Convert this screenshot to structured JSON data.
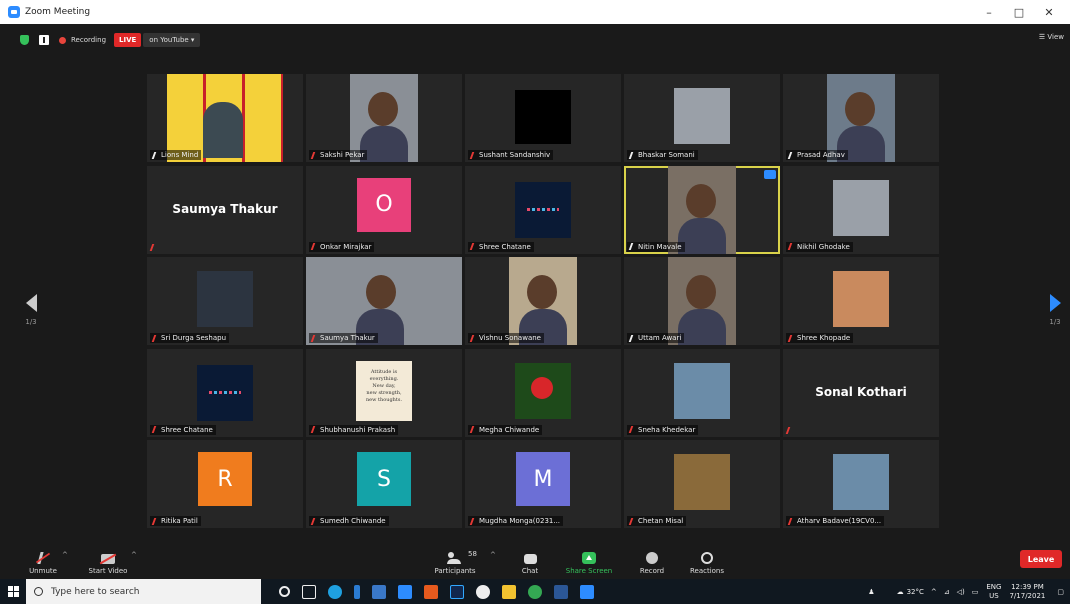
{
  "window": {
    "title": "Zoom Meeting",
    "controls": [
      "–",
      "□",
      "✕"
    ]
  },
  "topbar": {
    "recording": "Recording",
    "live": "LIVE",
    "live_target": "on YouTube ▾",
    "view": "☰ View"
  },
  "pager": {
    "left": "1/3",
    "right": "1/3"
  },
  "participants": [
    {
      "name": "Lions Mind",
      "type": "logo",
      "muted": false
    },
    {
      "name": "Sakshi Pekar",
      "type": "video",
      "muted": true
    },
    {
      "name": "Sushant Sandanshiv",
      "type": "black",
      "muted": true
    },
    {
      "name": "Bhaskar Somani",
      "type": "photo",
      "muted": false
    },
    {
      "name": "Prasad Adhav",
      "type": "video",
      "muted": false
    },
    {
      "name": "Saumya Thakur",
      "type": "name",
      "muted": true
    },
    {
      "name": "Onkar Mirajkar",
      "type": "avatar",
      "letter": "O",
      "color": "#e8407a",
      "muted": true
    },
    {
      "name": "Shree Chatane",
      "type": "dots",
      "muted": true
    },
    {
      "name": "Nitin Mavale",
      "type": "video",
      "muted": false,
      "active": true
    },
    {
      "name": "Nikhil Ghodake",
      "type": "photo",
      "muted": true
    },
    {
      "name": "Sri Durga Seshapu",
      "type": "photo",
      "muted": true
    },
    {
      "name": "Saumya Thakur",
      "type": "video",
      "muted": true
    },
    {
      "name": "Vishnu Sonawane",
      "type": "video",
      "muted": true
    },
    {
      "name": "Uttam Awari",
      "type": "video",
      "muted": false
    },
    {
      "name": "Shree Khopade",
      "type": "photo",
      "muted": true
    },
    {
      "name": "Shree Chatane",
      "type": "dots",
      "muted": true
    },
    {
      "name": "Shubhanushi Prakash",
      "type": "quote",
      "quote": [
        "Attitude is",
        "everything.",
        "New day,",
        "new strength,",
        "new thoughts."
      ],
      "muted": true
    },
    {
      "name": "Megha Chiwande",
      "type": "flower",
      "muted": true
    },
    {
      "name": "Sneha Khedekar",
      "type": "photo",
      "muted": true
    },
    {
      "name": "Sonal Kothari",
      "type": "name",
      "muted": true
    },
    {
      "name": "Ritika Patil",
      "type": "avatar",
      "letter": "R",
      "color": "#f07c1e",
      "muted": true
    },
    {
      "name": "Sumedh Chiwande",
      "type": "avatar",
      "letter": "S",
      "color": "#14a3a8",
      "muted": true
    },
    {
      "name": "Mugdha Monga(0231...",
      "type": "avatar",
      "letter": "M",
      "color": "#6c6fd6",
      "muted": true
    },
    {
      "name": "Chetan Misal",
      "type": "photo",
      "muted": true
    },
    {
      "name": "Atharv Badave(19CV0...",
      "type": "photo",
      "muted": true
    }
  ],
  "toolbar": {
    "unmute": "Unmute",
    "start_video": "Start Video",
    "participants": "Participants",
    "participant_count": "58",
    "chat": "Chat",
    "share_screen": "Share Screen",
    "record": "Record",
    "reactions": "Reactions",
    "leave": "Leave"
  },
  "taskbar": {
    "search_placeholder": "Type here to search",
    "weather": "32°C",
    "lang_top": "ENG",
    "lang_bottom": "US",
    "time": "12:39 PM",
    "date": "7/17/2021"
  }
}
